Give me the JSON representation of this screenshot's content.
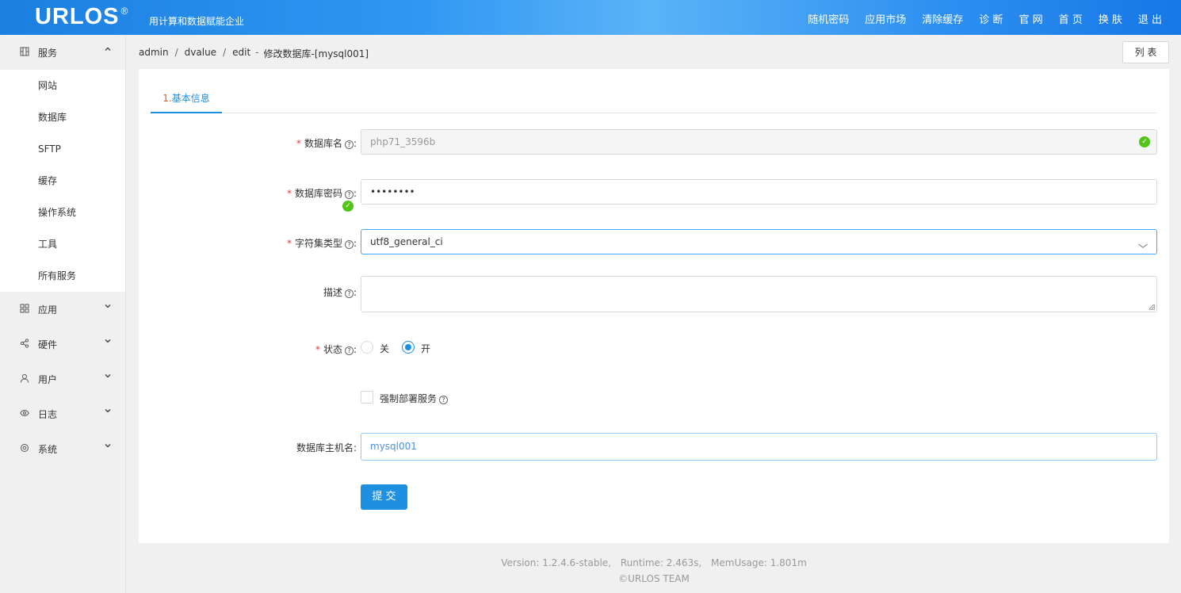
{
  "header": {
    "logo": "URLOS",
    "logo_mark": "®",
    "slogan": "用计算和数据赋能企业",
    "nav": [
      "随机密码",
      "应用市场",
      "清除缓存",
      "诊 断",
      "官 网",
      "首 页",
      "换 肤",
      "退 出"
    ]
  },
  "sidebar": {
    "groups": [
      {
        "label": "服务",
        "icon": "grid-icon",
        "expanded": true,
        "items": [
          "网站",
          "数据库",
          "SFTP",
          "缓存",
          "操作系统",
          "工具",
          "所有服务"
        ]
      },
      {
        "label": "应用",
        "icon": "apps-icon"
      },
      {
        "label": "硬件",
        "icon": "share-icon"
      },
      {
        "label": "用户",
        "icon": "user-icon"
      },
      {
        "label": "日志",
        "icon": "eye-icon"
      },
      {
        "label": "系统",
        "icon": "settings-icon"
      }
    ]
  },
  "breadcrumb": {
    "items": [
      "admin",
      "dvalue",
      "edit"
    ],
    "current": "修改数据库-[mysql001]",
    "dash": "-"
  },
  "list_button": "列 表",
  "tabs": [
    {
      "num": "1.",
      "label": "基本信息"
    }
  ],
  "form": {
    "db_name": {
      "label": "数据库名",
      "value": "php71_3596b"
    },
    "db_password": {
      "label": "数据库密码",
      "value": "••••••••"
    },
    "charset": {
      "label": "字符集类型",
      "value": "utf8_general_ci"
    },
    "description": {
      "label": "描述",
      "value": ""
    },
    "status": {
      "label": "状态",
      "options": [
        "关",
        "开"
      ],
      "selected": "开"
    },
    "force_deploy": {
      "label": "强制部署服务",
      "checked": false
    },
    "hostname": {
      "label": "数据库主机名",
      "value": "mysql001"
    },
    "colon": ":",
    "submit": "提 交"
  },
  "footer": {
    "version": "Version: 1.2.4.6-stable,",
    "runtime": "Runtime: 2.463s,",
    "mem": "MemUsage: 1.801m",
    "team": "©URLOS TEAM"
  },
  "colors": {
    "primary": "#1e8fe1",
    "success": "#52c41a",
    "required": "#e23a3a"
  }
}
